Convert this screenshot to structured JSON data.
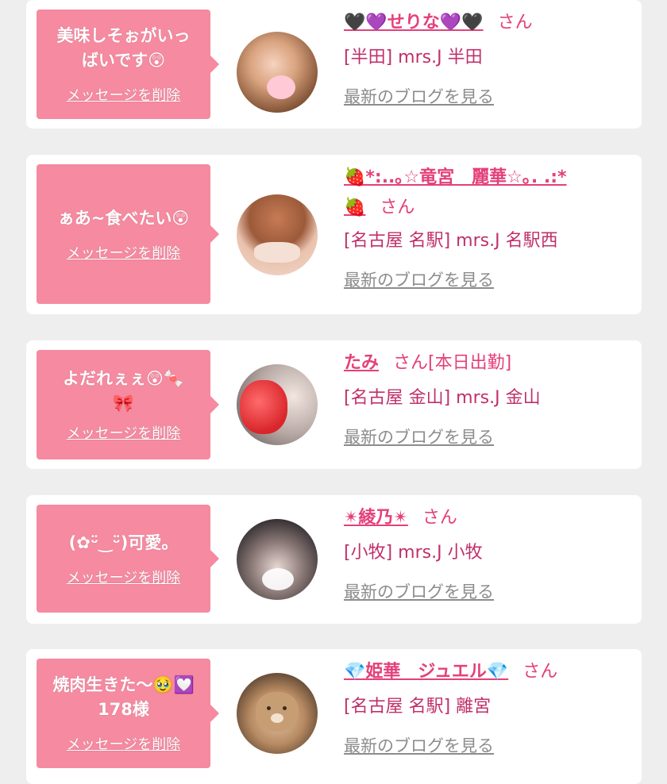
{
  "cards": [
    {
      "message_line1": "美味しそぉがいっ",
      "message_line2": "ばいです😲",
      "delete_label": "メッセージを削除",
      "name": "🖤💜せりな💜🖤",
      "honorific": "さん",
      "name_line2": "",
      "shop": "[半田] mrs.J 半田",
      "blog_label": "最新のブログを見る"
    },
    {
      "message_line1": "ぁあ~食べたい😲",
      "message_line2": "",
      "delete_label": "メッセージを削除",
      "name": "🍓*:..｡☆竜宮　麗華☆｡. .:*",
      "honorific": "さん",
      "name_line2": "🍓",
      "shop": "[名古屋 名駅] mrs.J 名駅西",
      "blog_label": "最新のブログを見る"
    },
    {
      "message_line1": "よだれぇぇ😲🍬",
      "message_line2": "🎀",
      "delete_label": "メッセージを削除",
      "name": "たみ",
      "honorific": "さん[本日出勤]",
      "name_line2": "",
      "shop": "[名古屋 金山] mrs.J 金山",
      "blog_label": "最新のブログを見る"
    },
    {
      "message_line1": "(✿ᵕ̈‿ᵕ̈)可愛。",
      "message_line2": "",
      "delete_label": "メッセージを削除",
      "name": "✴綾乃✴",
      "honorific": "さん",
      "name_line2": "",
      "shop": "[小牧] mrs.J 小牧",
      "blog_label": "最新のブログを見る"
    },
    {
      "message_line1": "焼肉生きた〜🥹💟",
      "message_line2": "178様",
      "delete_label": "メッセージを削除",
      "name": "💎姫華　ジュエル💎",
      "honorific": "さん",
      "name_line2": "",
      "shop": "[名古屋 名駅] 離宮",
      "blog_label": "最新のブログを見る"
    }
  ],
  "colors": {
    "bubble": "#f58aa0",
    "accent": "#e4407a",
    "background": "#eeeeee"
  }
}
